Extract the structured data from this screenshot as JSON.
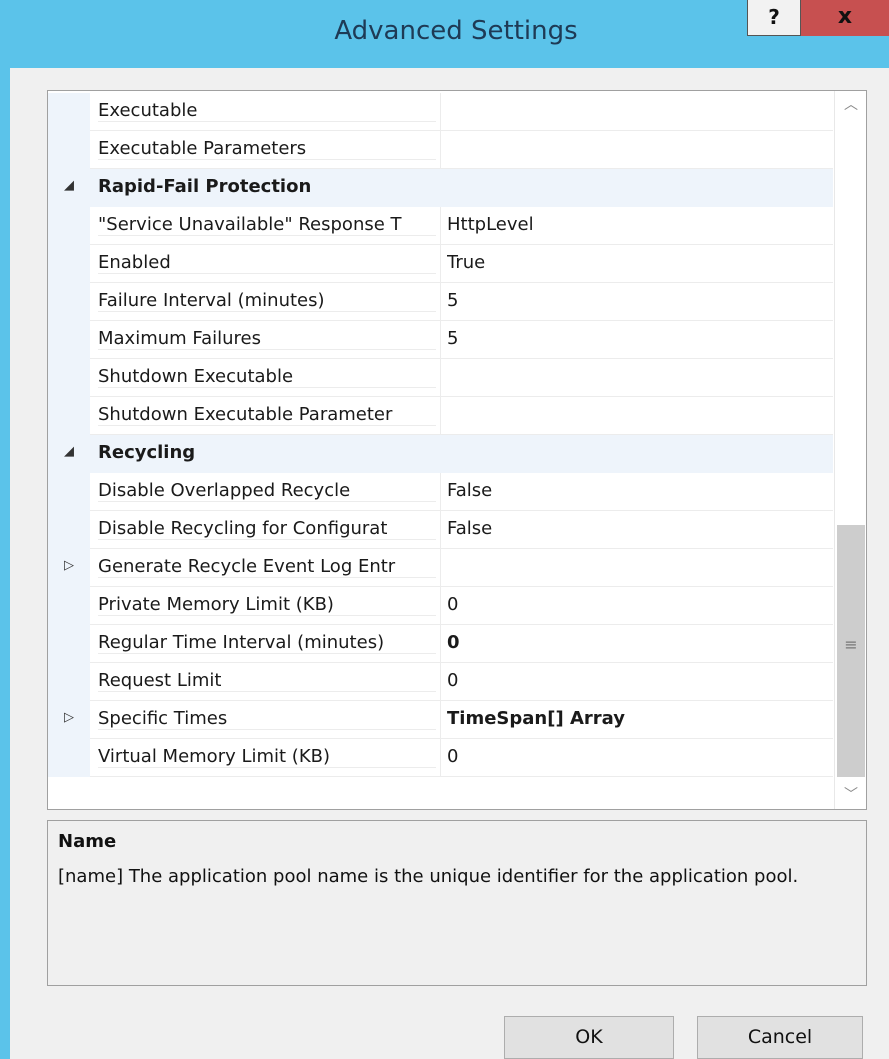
{
  "window": {
    "title": "Advanced Settings",
    "help_label": "?",
    "close_label": "x"
  },
  "grid": {
    "rows": [
      {
        "type": "prop",
        "name": "Executable",
        "value": ""
      },
      {
        "type": "prop",
        "name": "Executable Parameters",
        "value": ""
      },
      {
        "type": "cat",
        "glyph": "◢",
        "name": "Rapid-Fail Protection",
        "value": ""
      },
      {
        "type": "prop",
        "name": "\"Service Unavailable\" Response T",
        "value": "HttpLevel"
      },
      {
        "type": "prop",
        "name": "Enabled",
        "value": "True"
      },
      {
        "type": "prop",
        "name": "Failure Interval (minutes)",
        "value": "5"
      },
      {
        "type": "prop",
        "name": "Maximum Failures",
        "value": "5"
      },
      {
        "type": "prop",
        "name": "Shutdown Executable",
        "value": ""
      },
      {
        "type": "prop",
        "name": "Shutdown Executable Parameter",
        "value": ""
      },
      {
        "type": "cat",
        "glyph": "◢",
        "name": "Recycling",
        "value": ""
      },
      {
        "type": "prop",
        "name": "Disable Overlapped Recycle",
        "value": "False"
      },
      {
        "type": "prop",
        "name": "Disable Recycling for Configurat",
        "value": "False"
      },
      {
        "type": "prop",
        "glyph": "▷",
        "name": "Generate Recycle Event Log Entr",
        "value": ""
      },
      {
        "type": "prop",
        "name": "Private Memory Limit (KB)",
        "value": "0"
      },
      {
        "type": "prop",
        "name": "Regular Time Interval (minutes)",
        "value": "0",
        "bold": true
      },
      {
        "type": "prop",
        "name": "Request Limit",
        "value": "0"
      },
      {
        "type": "prop",
        "glyph": "▷",
        "name": "Specific Times",
        "value": "TimeSpan[] Array",
        "bold": true
      },
      {
        "type": "prop",
        "name": "Virtual Memory Limit (KB)",
        "value": "0"
      }
    ]
  },
  "scrollbar": {
    "up_icon": "chevron-up-icon",
    "down_icon": "chevron-down-icon",
    "grip_icon": "grip-icon"
  },
  "description": {
    "title": "Name",
    "text": "[name] The application pool name is the unique identifier for the application pool."
  },
  "buttons": {
    "ok": "OK",
    "cancel": "Cancel"
  }
}
